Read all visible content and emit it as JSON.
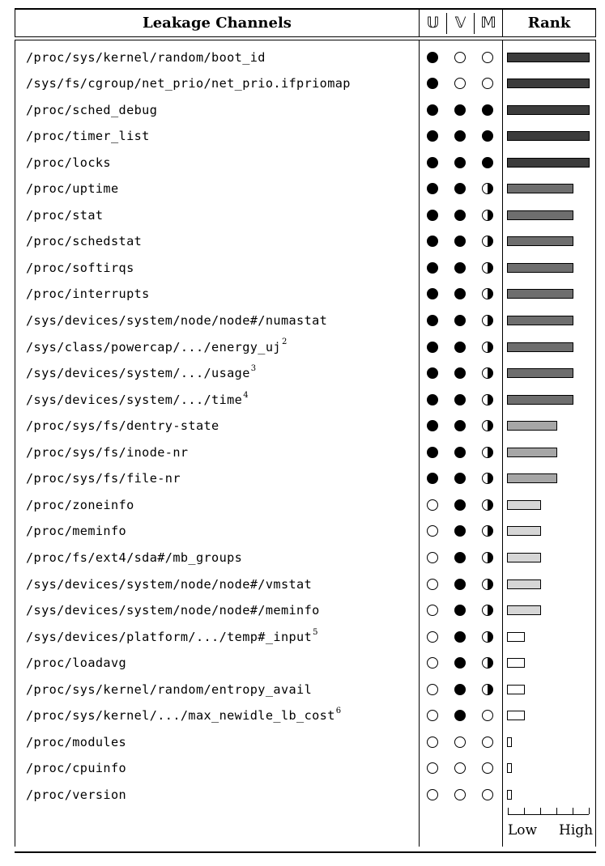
{
  "header": {
    "channels": "Leakage Channels",
    "col_u": "𝕌",
    "col_v": "𝕍",
    "col_m": "𝕄",
    "rank": "Rank"
  },
  "legend_markers": [
    "full",
    "half",
    "empty"
  ],
  "colors": {
    "rank_5": "#3c3c3c",
    "rank_4": "#6e6e6e",
    "rank_3": "#a6a6a6",
    "rank_2": "#d6d6d6",
    "rank_1": "#ffffff",
    "rank_0": "#ffffff"
  },
  "rows": [
    {
      "path": "/proc/sys/kernel/random/boot_id",
      "note": "",
      "u": "full",
      "v": "empty",
      "m": "empty",
      "rank": 5
    },
    {
      "path": "/sys/fs/cgroup/net_prio/net_prio.ifpriomap",
      "note": "",
      "u": "full",
      "v": "empty",
      "m": "empty",
      "rank": 5
    },
    {
      "path": "/proc/sched_debug",
      "note": "",
      "u": "full",
      "v": "full",
      "m": "full",
      "rank": 5
    },
    {
      "path": "/proc/timer_list",
      "note": "",
      "u": "full",
      "v": "full",
      "m": "full",
      "rank": 5
    },
    {
      "path": "/proc/locks",
      "note": "",
      "u": "full",
      "v": "full",
      "m": "full",
      "rank": 5
    },
    {
      "path": "/proc/uptime",
      "note": "",
      "u": "full",
      "v": "full",
      "m": "half",
      "rank": 4
    },
    {
      "path": "/proc/stat",
      "note": "",
      "u": "full",
      "v": "full",
      "m": "half",
      "rank": 4
    },
    {
      "path": "/proc/schedstat",
      "note": "",
      "u": "full",
      "v": "full",
      "m": "half",
      "rank": 4
    },
    {
      "path": "/proc/softirqs",
      "note": "",
      "u": "full",
      "v": "full",
      "m": "half",
      "rank": 4
    },
    {
      "path": "/proc/interrupts",
      "note": "",
      "u": "full",
      "v": "full",
      "m": "half",
      "rank": 4
    },
    {
      "path": "/sys/devices/system/node/node#/numastat",
      "note": "",
      "u": "full",
      "v": "full",
      "m": "half",
      "rank": 4
    },
    {
      "path": "/sys/class/powercap/.../energy_uj",
      "note": "2",
      "u": "full",
      "v": "full",
      "m": "half",
      "rank": 4
    },
    {
      "path": "/sys/devices/system/.../usage",
      "note": "3",
      "u": "full",
      "v": "full",
      "m": "half",
      "rank": 4
    },
    {
      "path": "/sys/devices/system/.../time",
      "note": "4",
      "u": "full",
      "v": "full",
      "m": "half",
      "rank": 4
    },
    {
      "path": "/proc/sys/fs/dentry-state",
      "note": "",
      "u": "full",
      "v": "full",
      "m": "half",
      "rank": 3
    },
    {
      "path": "/proc/sys/fs/inode-nr",
      "note": "",
      "u": "full",
      "v": "full",
      "m": "half",
      "rank": 3
    },
    {
      "path": "/proc/sys/fs/file-nr",
      "note": "",
      "u": "full",
      "v": "full",
      "m": "half",
      "rank": 3
    },
    {
      "path": "/proc/zoneinfo",
      "note": "",
      "u": "empty",
      "v": "full",
      "m": "half",
      "rank": 2
    },
    {
      "path": "/proc/meminfo",
      "note": "",
      "u": "empty",
      "v": "full",
      "m": "half",
      "rank": 2
    },
    {
      "path": "/proc/fs/ext4/sda#/mb_groups",
      "note": "",
      "u": "empty",
      "v": "full",
      "m": "half",
      "rank": 2
    },
    {
      "path": "/sys/devices/system/node/node#/vmstat",
      "note": "",
      "u": "empty",
      "v": "full",
      "m": "half",
      "rank": 2
    },
    {
      "path": "/sys/devices/system/node/node#/meminfo",
      "note": "",
      "u": "empty",
      "v": "full",
      "m": "half",
      "rank": 2
    },
    {
      "path": "/sys/devices/platform/.../temp#_input",
      "note": "5",
      "u": "empty",
      "v": "full",
      "m": "half",
      "rank": 1
    },
    {
      "path": "/proc/loadavg",
      "note": "",
      "u": "empty",
      "v": "full",
      "m": "half",
      "rank": 1
    },
    {
      "path": "/proc/sys/kernel/random/entropy_avail",
      "note": "",
      "u": "empty",
      "v": "full",
      "m": "half",
      "rank": 1
    },
    {
      "path": "/proc/sys/kernel/.../max_newidle_lb_cost",
      "note": "6",
      "u": "empty",
      "v": "full",
      "m": "empty",
      "rank": 1
    },
    {
      "path": "/proc/modules",
      "note": "",
      "u": "empty",
      "v": "empty",
      "m": "empty",
      "rank": 0
    },
    {
      "path": "/proc/cpuinfo",
      "note": "",
      "u": "empty",
      "v": "empty",
      "m": "empty",
      "rank": 0
    },
    {
      "path": "/proc/version",
      "note": "",
      "u": "empty",
      "v": "empty",
      "m": "empty",
      "rank": 0
    }
  ],
  "scale": {
    "low": "Low",
    "high": "High",
    "ticks": 6
  }
}
